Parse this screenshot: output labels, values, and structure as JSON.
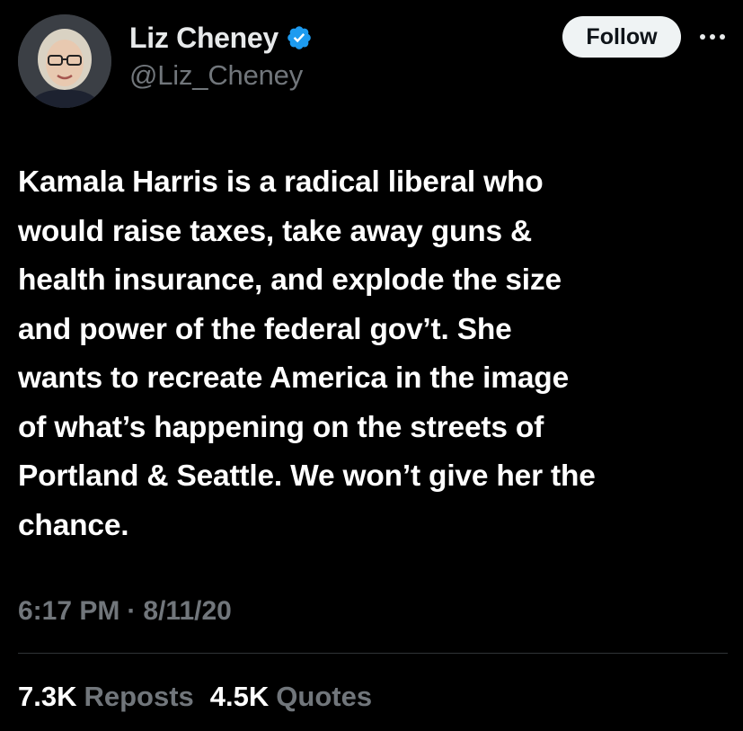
{
  "author": {
    "display_name": "Liz Cheney",
    "handle": "@Liz_Cheney",
    "verified": true,
    "verified_icon": "verified-badge-icon",
    "verified_color": "#1d9bf0",
    "avatar_icon": "profile-photo"
  },
  "actions": {
    "follow_label": "Follow",
    "more_icon": "more-horizontal-icon"
  },
  "tweet": {
    "text": "Kamala Harris is a radical liberal who\nwould raise taxes, take away guns &\nhealth insurance, and explode the size\nand power of the federal gov’t. She\nwants to recreate America in the image\nof what’s happening on the streets of\nPortland & Seattle. We won’t give her the\nchance.",
    "time": "6:17 PM",
    "separator": "·",
    "date": "8/11/20"
  },
  "stats": {
    "reposts_count": "7.3K",
    "reposts_label": "Reposts",
    "quotes_count": "4.5K",
    "quotes_label": "Quotes"
  },
  "colors": {
    "background": "#000000",
    "text_primary": "#e7e9ea",
    "text_secondary": "#71767b",
    "divider": "#2f3336",
    "follow_button_bg": "#eff3f4"
  }
}
